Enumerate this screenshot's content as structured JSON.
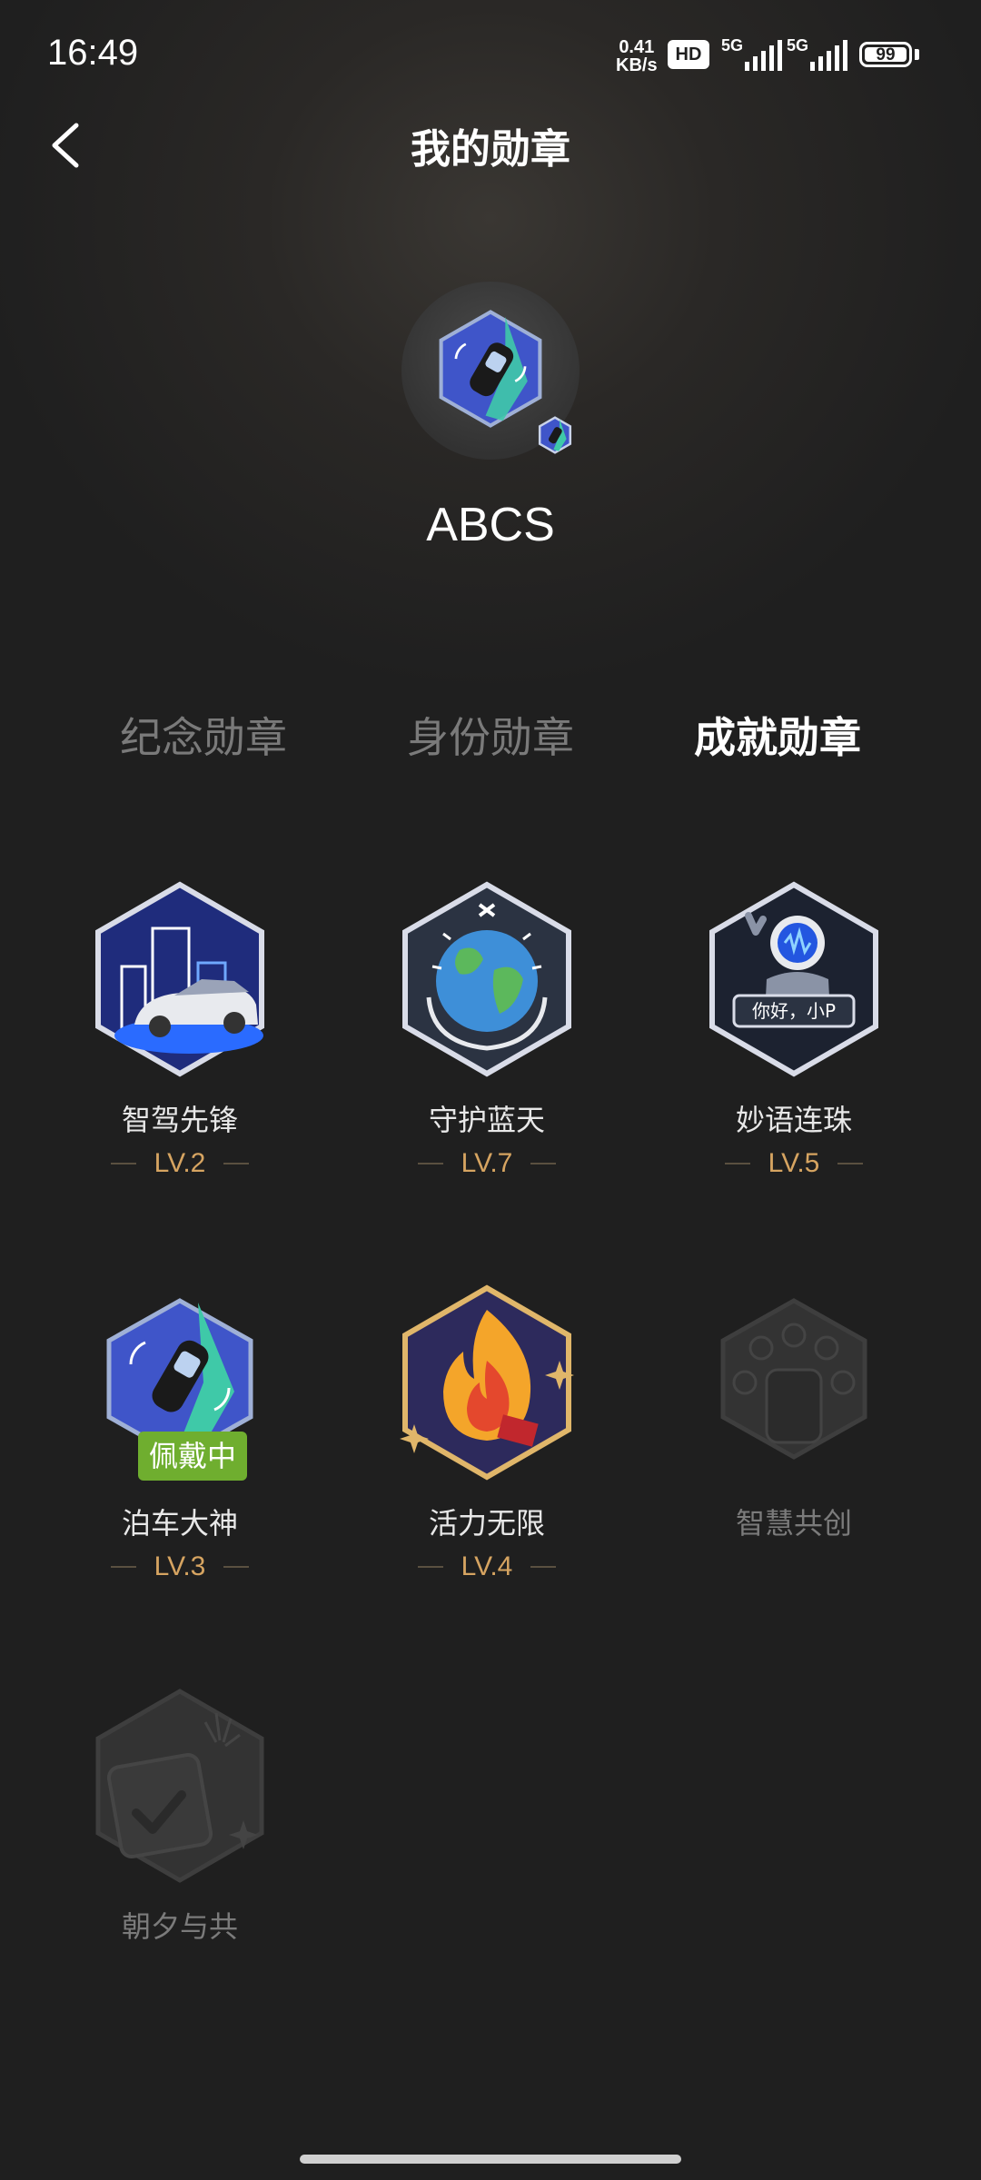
{
  "status_bar": {
    "time": "16:49",
    "net_speed_value": "0.41",
    "net_speed_unit": "KB/s",
    "hd_label": "HD",
    "signal1_label": "5G",
    "signal2_label": "5G",
    "battery_level": "99"
  },
  "header": {
    "title": "我的勋章",
    "back_icon": "chevron-left-icon"
  },
  "profile": {
    "username": "ABCS",
    "avatar_badge": "parking-car-badge"
  },
  "tabs": [
    {
      "label": "纪念勋章",
      "active": false
    },
    {
      "label": "身份勋章",
      "active": false
    },
    {
      "label": "成就勋章",
      "active": true
    }
  ],
  "badges": [
    {
      "name": "智驾先锋",
      "level": "LV.2",
      "locked": false,
      "icon": "smart-driving-car-icon"
    },
    {
      "name": "守护蓝天",
      "level": "LV.7",
      "locked": false,
      "icon": "earth-hands-icon"
    },
    {
      "name": "妙语连珠",
      "level": "LV.5",
      "locked": false,
      "icon": "robot-greeting-icon",
      "bubble_text": "你好，小P"
    },
    {
      "name": "泊车大神",
      "level": "LV.3",
      "locked": false,
      "icon": "parking-car-icon",
      "wearing_label": "佩戴中"
    },
    {
      "name": "活力无限",
      "level": "LV.4",
      "locked": false,
      "icon": "fire-icon"
    },
    {
      "name": "智慧共创",
      "level": "",
      "locked": true,
      "icon": "co-create-icon"
    },
    {
      "name": "朝夕与共",
      "level": "",
      "locked": true,
      "icon": "calendar-check-icon"
    }
  ],
  "colors": {
    "background": "#1f1f1f",
    "level_gold": "#d6a461",
    "wearing_green": "#6fae2f",
    "inactive_tab": "#7a7a7a"
  }
}
